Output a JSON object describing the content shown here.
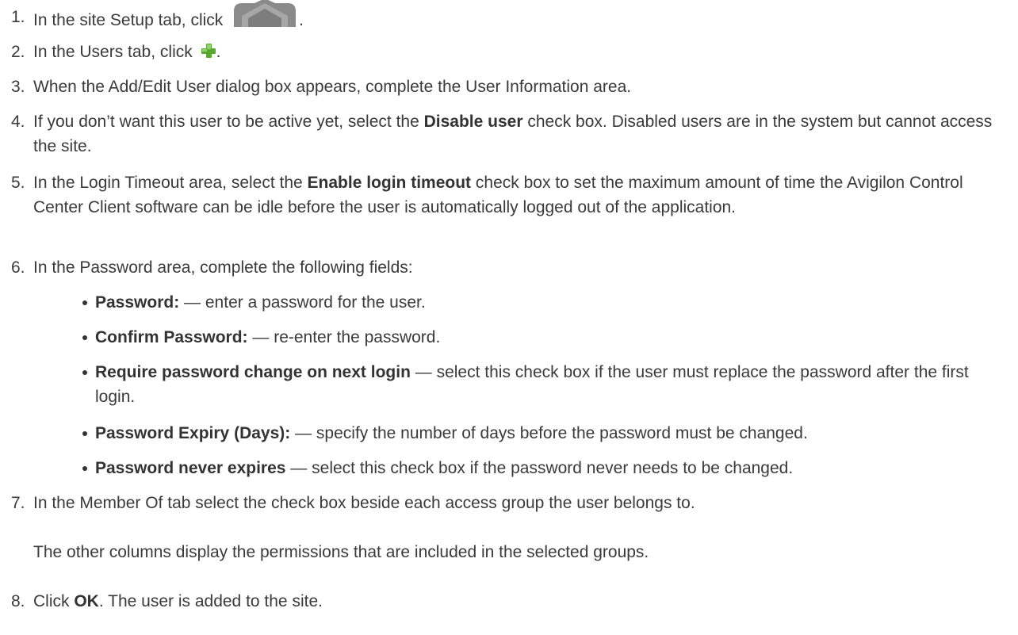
{
  "steps": [
    {
      "num": "1.",
      "pre": "In the site Setup tab, click ",
      "icon": "setup-tab-icon",
      "post": "."
    },
    {
      "num": "2.",
      "pre": "In the Users tab, click ",
      "icon": "add-icon",
      "post": "."
    },
    {
      "num": "3.",
      "text": "When the Add/Edit User dialog box appears, complete the User Information area."
    },
    {
      "num": "4.",
      "pre": "If you don’t want this user to be active yet, select the ",
      "bold": "Disable user",
      "post": " check box. Disabled users are in the system but cannot access the site."
    },
    {
      "num": "5.",
      "pre": "In the Login Timeout area, select the ",
      "bold": "Enable login timeout",
      "post": " check box to set the maximum amount of time the Avigilon Control Center Client software can be idle before the user is automatically logged out of the application."
    },
    {
      "num": "6.",
      "text": "In the Password area, complete the following fields:"
    },
    {
      "num": "7.",
      "text": "In the Member Of tab select the check box beside each access group the user belongs to."
    },
    {
      "num": "8.",
      "pre": "Click ",
      "bold": "OK",
      "post": ". The user is added to the site."
    }
  ],
  "bullets": [
    {
      "bold": "Password:",
      "text": " — enter a password for the user."
    },
    {
      "bold": "Confirm Password:",
      "text": " — re-enter the password."
    },
    {
      "bold": "Require password change on next login",
      "text": " — select this check box if the user must replace the password after the first login."
    },
    {
      "bold": "Password Expiry (Days):",
      "text": " — specify the number of days before the password must be changed."
    },
    {
      "bold": "Password never expires",
      "text": " — select this check box if the password never needs to be changed."
    }
  ],
  "note": "The other columns display the permissions that are included in the selected groups.",
  "colors": {
    "text": "#3a3a3a",
    "icon_gray": "#8c8c8c",
    "add_green": "#5aa832"
  }
}
